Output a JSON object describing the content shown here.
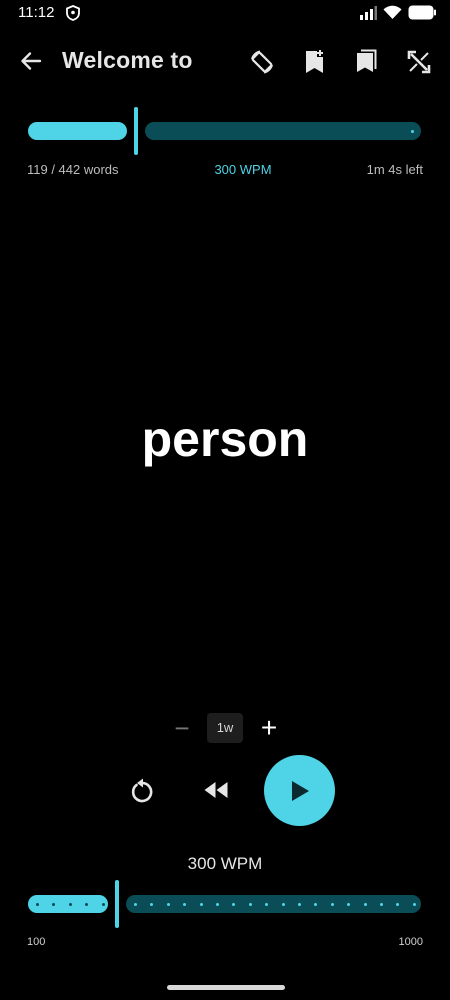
{
  "status_bar": {
    "time": "11:12",
    "icons": [
      "shield-icon",
      "signal-icon",
      "wifi-icon",
      "battery-icon"
    ]
  },
  "app_bar": {
    "title": "Welcome to",
    "icons": [
      "back-arrow-icon",
      "screen-rotation-icon",
      "bookmark-add-icon",
      "bookmarks-icon",
      "fullscreen-icon"
    ]
  },
  "progress": {
    "fraction": 0.269,
    "words_read": "119 / 442 words",
    "wpm": "300 WPM",
    "time_left": "1m 4s left"
  },
  "reader": {
    "current_word": "person"
  },
  "chunk_stepper": {
    "minus_label": "−",
    "value": "1w",
    "plus_label": "+"
  },
  "playback": {
    "icons": [
      "replay-icon",
      "rewind-icon",
      "play-icon"
    ]
  },
  "speed": {
    "label": "300 WPM",
    "value": 300,
    "min_label": "100",
    "max_label": "1000",
    "min": 100,
    "max": 1000
  },
  "colors": {
    "accent": "#4ed4e6",
    "track_inactive": "#0a4d57",
    "background": "#000000"
  }
}
